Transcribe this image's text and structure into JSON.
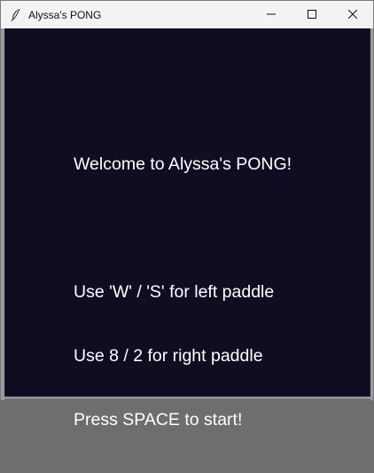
{
  "window": {
    "title": "Alyssa's PONG",
    "icon": "feather-icon",
    "controls": [
      "minimize-icon",
      "maximize-icon",
      "close-icon"
    ]
  },
  "canvas": {
    "background": "#100d22",
    "text_color": "#ffffff",
    "lines": [
      "Welcome to Alyssa's PONG!",
      "",
      "Use 'W' / 'S' for left paddle",
      "Use 8 / 2 for right paddle",
      "Press SPACE to start!"
    ]
  }
}
